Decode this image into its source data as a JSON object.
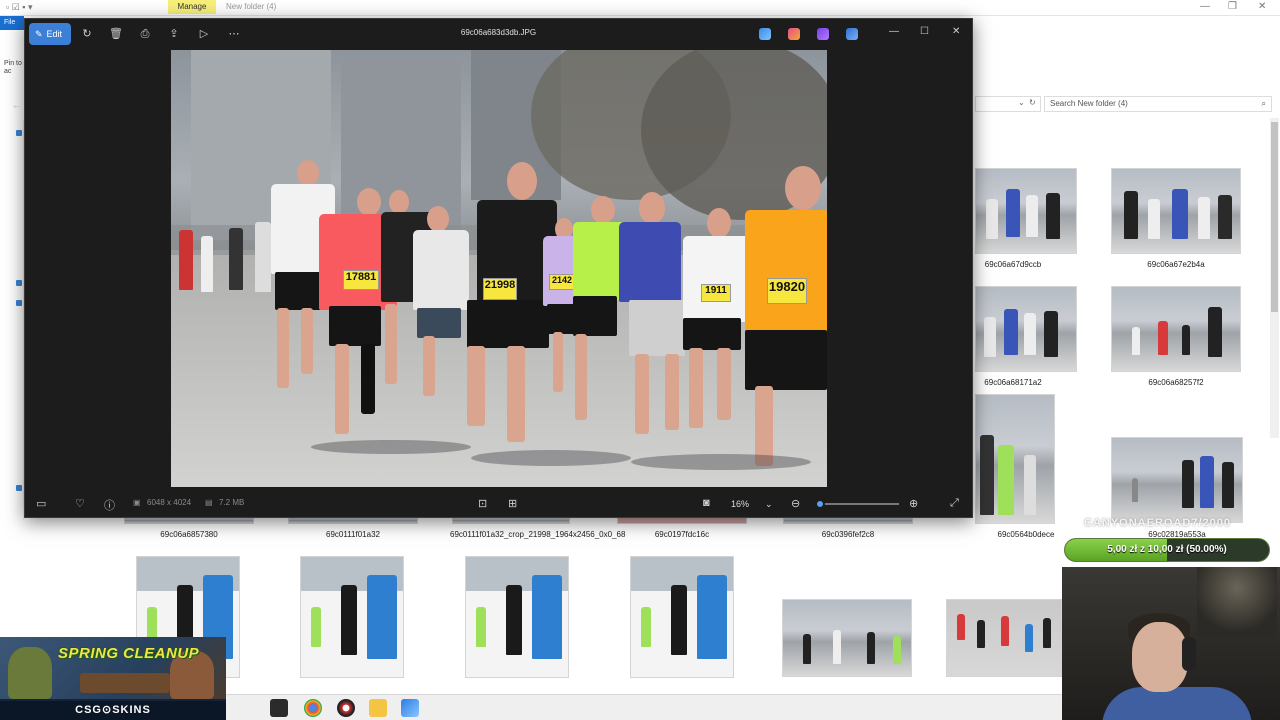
{
  "explorer": {
    "manage_tab": "Manage",
    "folder_title": "New folder (4)",
    "file_tab": "File",
    "pin_text": "Pin to ac",
    "search_placeholder": "Search New folder (4)",
    "thumbnails_right": [
      {
        "label": "69c06a67d9ccb"
      },
      {
        "label": "69c06a67e2b4a"
      },
      {
        "label": "69c06a68171a2"
      },
      {
        "label": "69c06a68257f2"
      },
      {
        "label": "69c0564b0dece"
      },
      {
        "label": "69c02819a553a"
      }
    ],
    "thumbnails_row": [
      {
        "label": "69c06a6857380"
      },
      {
        "label": "69c0111f01a32"
      },
      {
        "label": "69c0111f01a32_crop_21998_1964x2456_0x0_68"
      },
      {
        "label": "69c0197fdc16c"
      },
      {
        "label": "69c0396fef2c8"
      }
    ]
  },
  "viewer": {
    "edit_label": "Edit",
    "file_name": "69c06a683d3db.JPG",
    "dimensions": "6048 x 4024",
    "file_size": "7.2 MB",
    "zoom": "16%",
    "zoom_fraction": 0.16,
    "bibs": [
      "17881",
      "21998",
      "2142",
      "1911",
      "19820"
    ],
    "icons": {
      "rotate": "rotate-icon",
      "delete": "delete-icon",
      "print": "print-icon",
      "share": "share-icon",
      "slideshow": "slideshow-icon",
      "more": "more-icon",
      "filmstrip": "filmstrip-icon",
      "favorite": "heart-icon",
      "info": "info-icon",
      "fit": "fit-icon",
      "actual_size": "actual-size-icon",
      "zoom_out": "zoom-out-icon",
      "zoom_in": "zoom-in-icon",
      "fullscreen": "fullscreen-icon"
    }
  },
  "overlays": {
    "watermark": "CANYONAEROAD7/2000",
    "donation_progress": "5,00 zł z 10,00 zł (50.00%)",
    "donation_fraction": 0.5,
    "ad_title": "SPRING CLEANUP",
    "ad_brand": "CSG⊙SKINS"
  },
  "colors": {
    "viewer_bg": "#1c1c1c",
    "accent": "#3b80d6",
    "progress": "#5aa424",
    "manage_tab": "#f8f07a"
  }
}
